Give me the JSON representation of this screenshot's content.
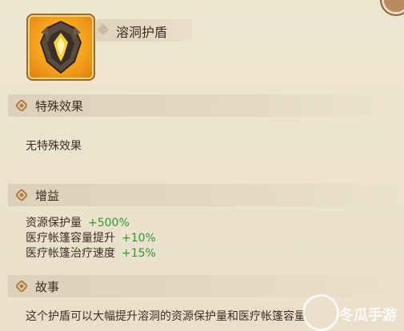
{
  "item": {
    "name": "溶洞护盾",
    "icon": "molten-shield-icon"
  },
  "sections": {
    "special": {
      "label": "特殊效果",
      "text": "无特殊效果"
    },
    "buffs": {
      "label": "增益",
      "rows": [
        {
          "label": "资源保护量",
          "value": "+500%"
        },
        {
          "label": "医疗帐篷容量提升",
          "value": "+10%"
        },
        {
          "label": "医疗帐篷治疗速度",
          "value": "+15%"
        }
      ]
    },
    "story": {
      "label": "故事",
      "text": "这个护盾可以大幅提升溶洞的资源保护量和医疗帐篷容量"
    }
  },
  "watermark": {
    "text": "冬瓜手游"
  },
  "colors": {
    "value_green": "#2e9a2e",
    "panel_bg": "#ece3cf",
    "icon_orange": "#f7a81e"
  }
}
